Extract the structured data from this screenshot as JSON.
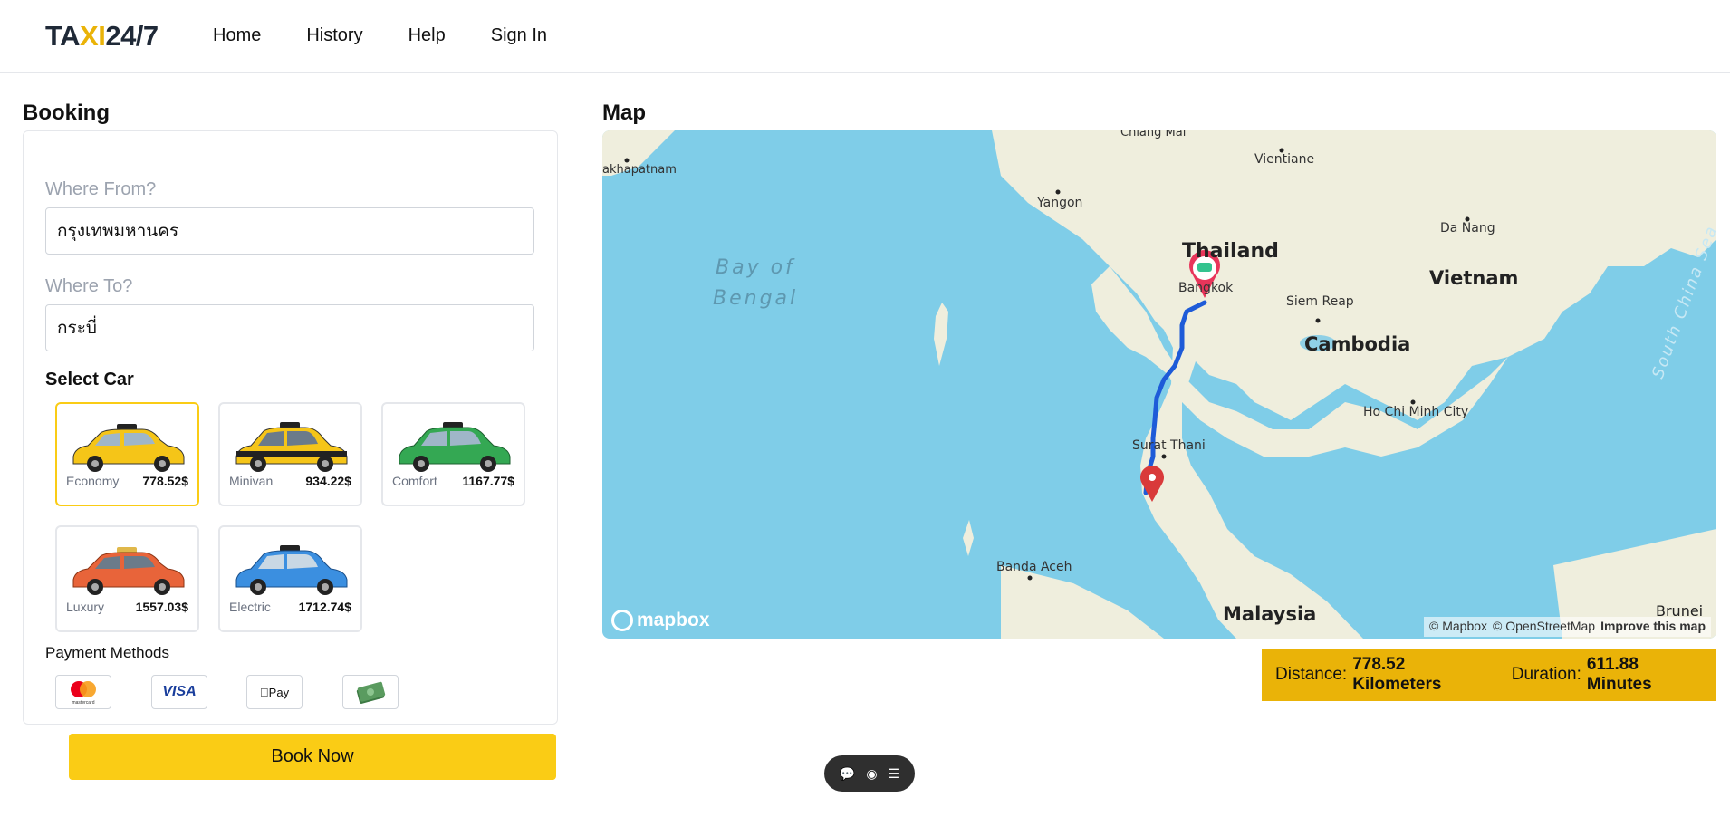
{
  "header": {
    "logo_a": "TA",
    "logo_b": "XI",
    "logo_c": "24/7",
    "nav": [
      "Home",
      "History",
      "Help",
      "Sign In"
    ]
  },
  "booking": {
    "title": "Booking",
    "from_label": "Where From?",
    "from_value": "กรุงเทพมหานคร",
    "to_label": "Where To?",
    "to_value": "กระบี่",
    "select_car_label": "Select Car",
    "cars": [
      {
        "name": "Economy",
        "price": "778.52$",
        "color": "#f5c518",
        "selected": true
      },
      {
        "name": "Minivan",
        "price": "934.22$",
        "color": "#f5c518",
        "selected": false
      },
      {
        "name": "Comfort",
        "price": "1167.77$",
        "color": "#34a853",
        "selected": false
      },
      {
        "name": "Luxury",
        "price": "1557.03$",
        "color": "#e8643a",
        "selected": false
      },
      {
        "name": "Electric",
        "price": "1712.74$",
        "color": "#3b8fe0",
        "selected": false
      }
    ],
    "payment_label": "Payment Methods",
    "payments": [
      "mastercard",
      "VISA",
      "Pay",
      "cash"
    ],
    "book_button": "Book Now"
  },
  "map": {
    "title": "Map",
    "labels": {
      "chiang_mai": "Chiang Mai",
      "vientiane": "Vientiane",
      "yangon": "Yangon",
      "da_nang": "Da Nang",
      "thailand": "Thailand",
      "bangkok": "Bangkok",
      "vietnam": "Vietnam",
      "bay_of": "Bay of",
      "bengal": "Bengal",
      "siem_reap": "Siem Reap",
      "cambodia": "Cambodia",
      "ho_chi_minh": "Ho Chi Minh City",
      "surat_thani": "Surat Thani",
      "banda_aceh": "Banda Aceh",
      "malaysia": "Malaysia",
      "brunei": "Brunei",
      "south_china_sea": "South China Sea",
      "vishakhapatnam": "akhapatnam"
    },
    "mapbox_logo": "mapbox",
    "attribution_mapbox": "© Mapbox",
    "attribution_osm": "© OpenStreetMap",
    "attribution_improve": "Improve this map",
    "route_color": "#1e5bd8",
    "land_color": "#efeedd",
    "water_color": "#7fcde8"
  },
  "trip": {
    "distance_label": "Distance:",
    "distance_value": "778.52 Kilometers",
    "duration_label": "Duration:",
    "duration_value": "611.88 Minutes"
  },
  "colors": {
    "accent": "#facc15",
    "info_bg": "#eab308"
  }
}
